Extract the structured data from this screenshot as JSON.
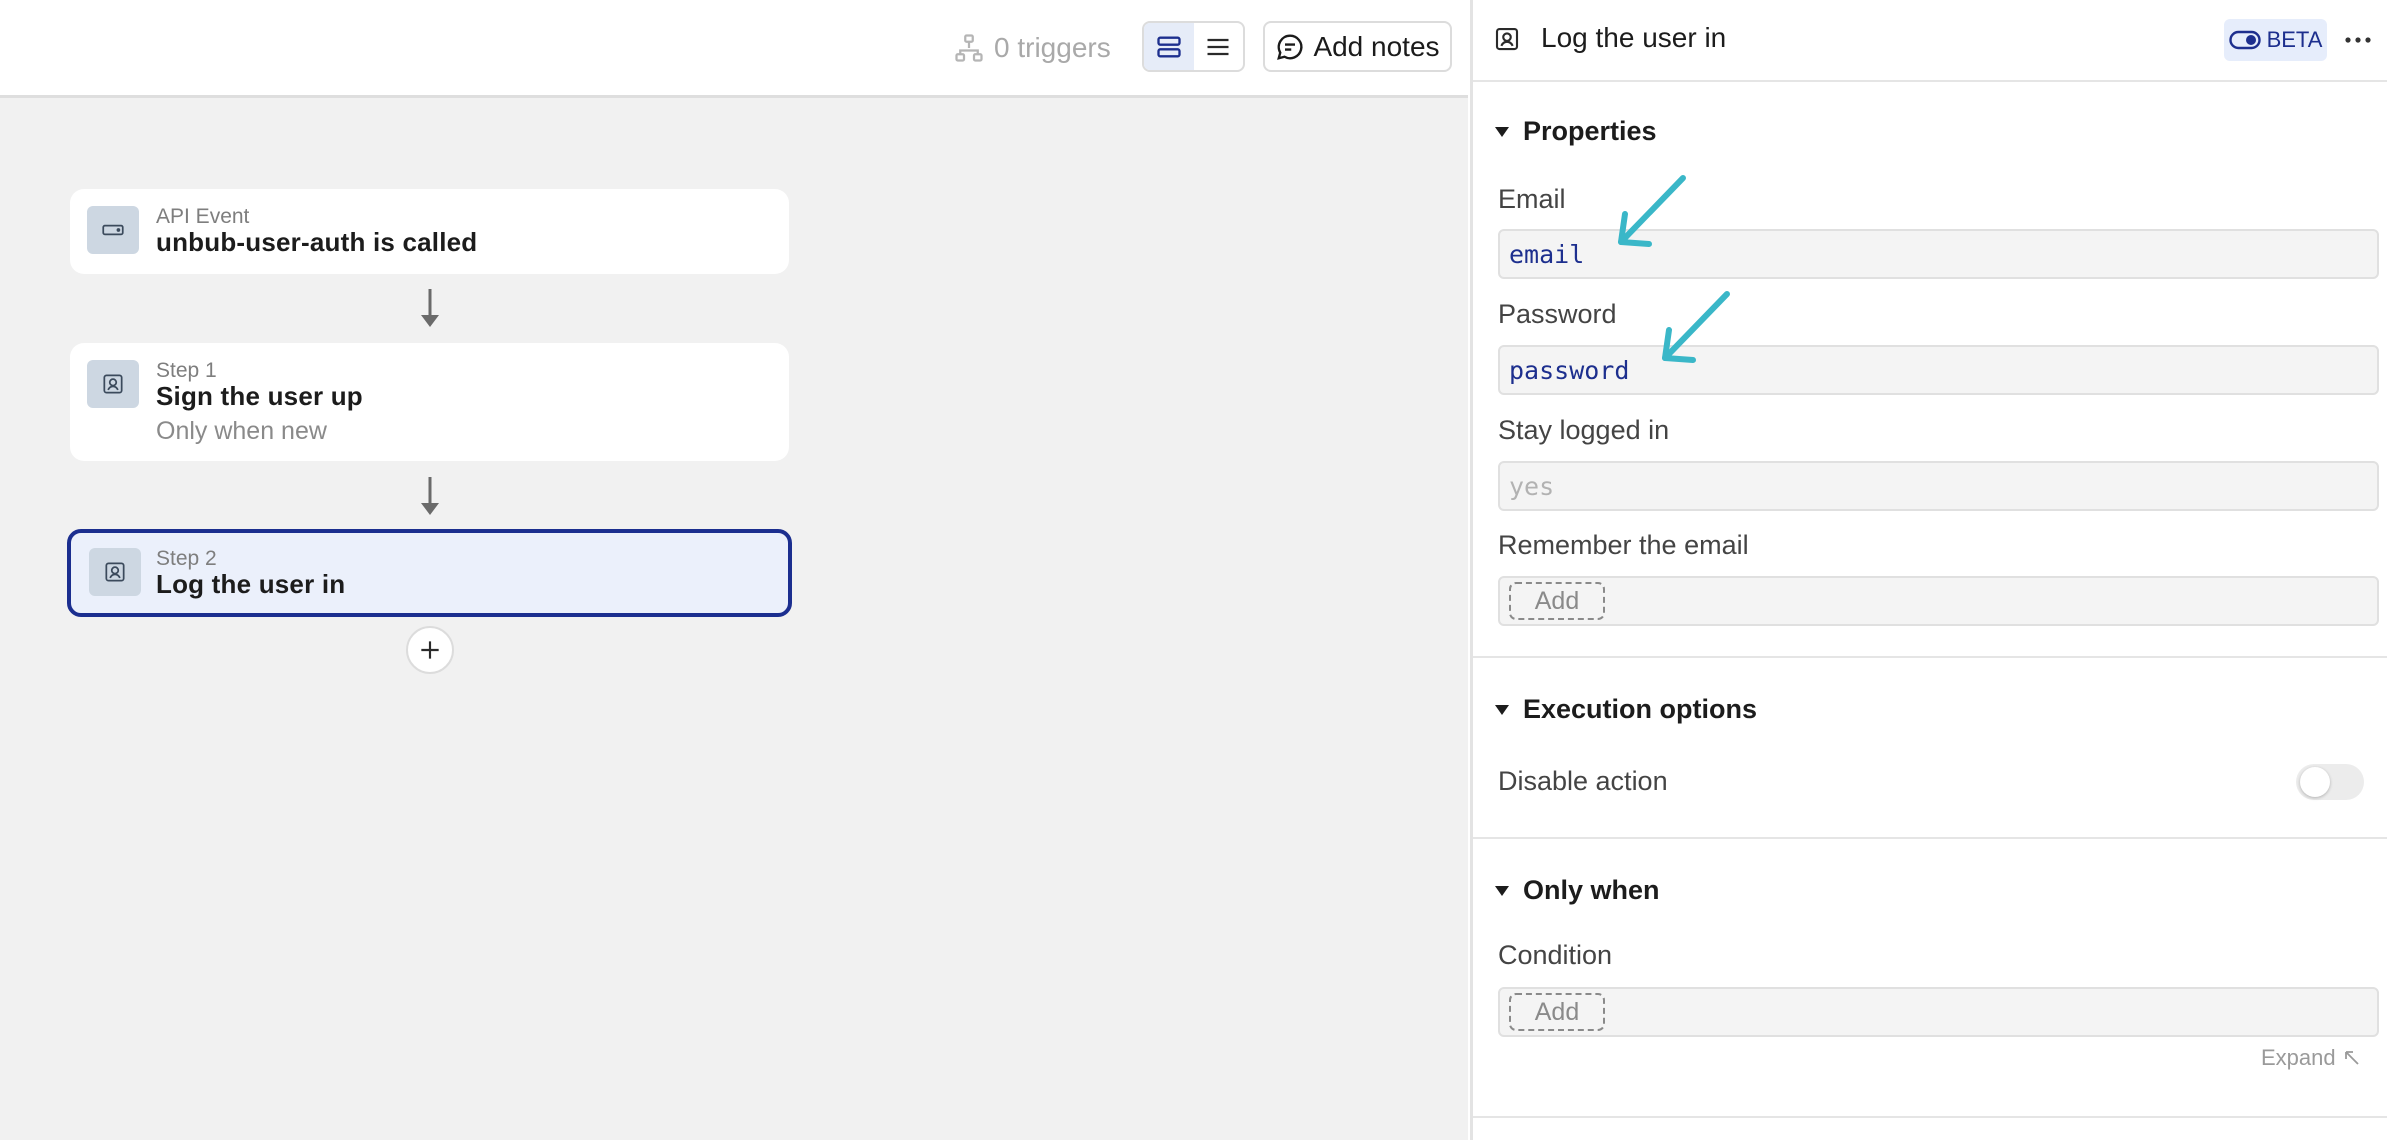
{
  "topbar": {
    "triggers_label": "0 triggers",
    "add_notes_label": "Add notes"
  },
  "flow": {
    "cards": [
      {
        "kind": "API Event",
        "title": "unbub-user-auth is called",
        "sub": ""
      },
      {
        "kind": "Step 1",
        "title": "Sign the user up",
        "sub": "Only when new"
      },
      {
        "kind": "Step 2",
        "title": "Log the user in",
        "sub": ""
      }
    ]
  },
  "panel": {
    "title": "Log the user in",
    "beta_label": "BETA",
    "sections": {
      "properties": "Properties",
      "execution": "Execution options",
      "only_when": "Only when"
    },
    "fields": {
      "email_label": "Email",
      "email_value": "email",
      "password_label": "Password",
      "password_value": "password",
      "stay_label": "Stay logged in",
      "stay_placeholder": "yes",
      "remember_label": "Remember the email",
      "remember_add": "Add",
      "disable_label": "Disable action",
      "condition_label": "Condition",
      "condition_add": "Add"
    },
    "disable_action_on": false,
    "expand_label": "Expand"
  },
  "colors": {
    "accent": "#1b2e8f",
    "selected_bg": "#ebf0fb",
    "annotation_arrow": "#3ab7c8",
    "canvas_bg": "#f1f1f1"
  }
}
